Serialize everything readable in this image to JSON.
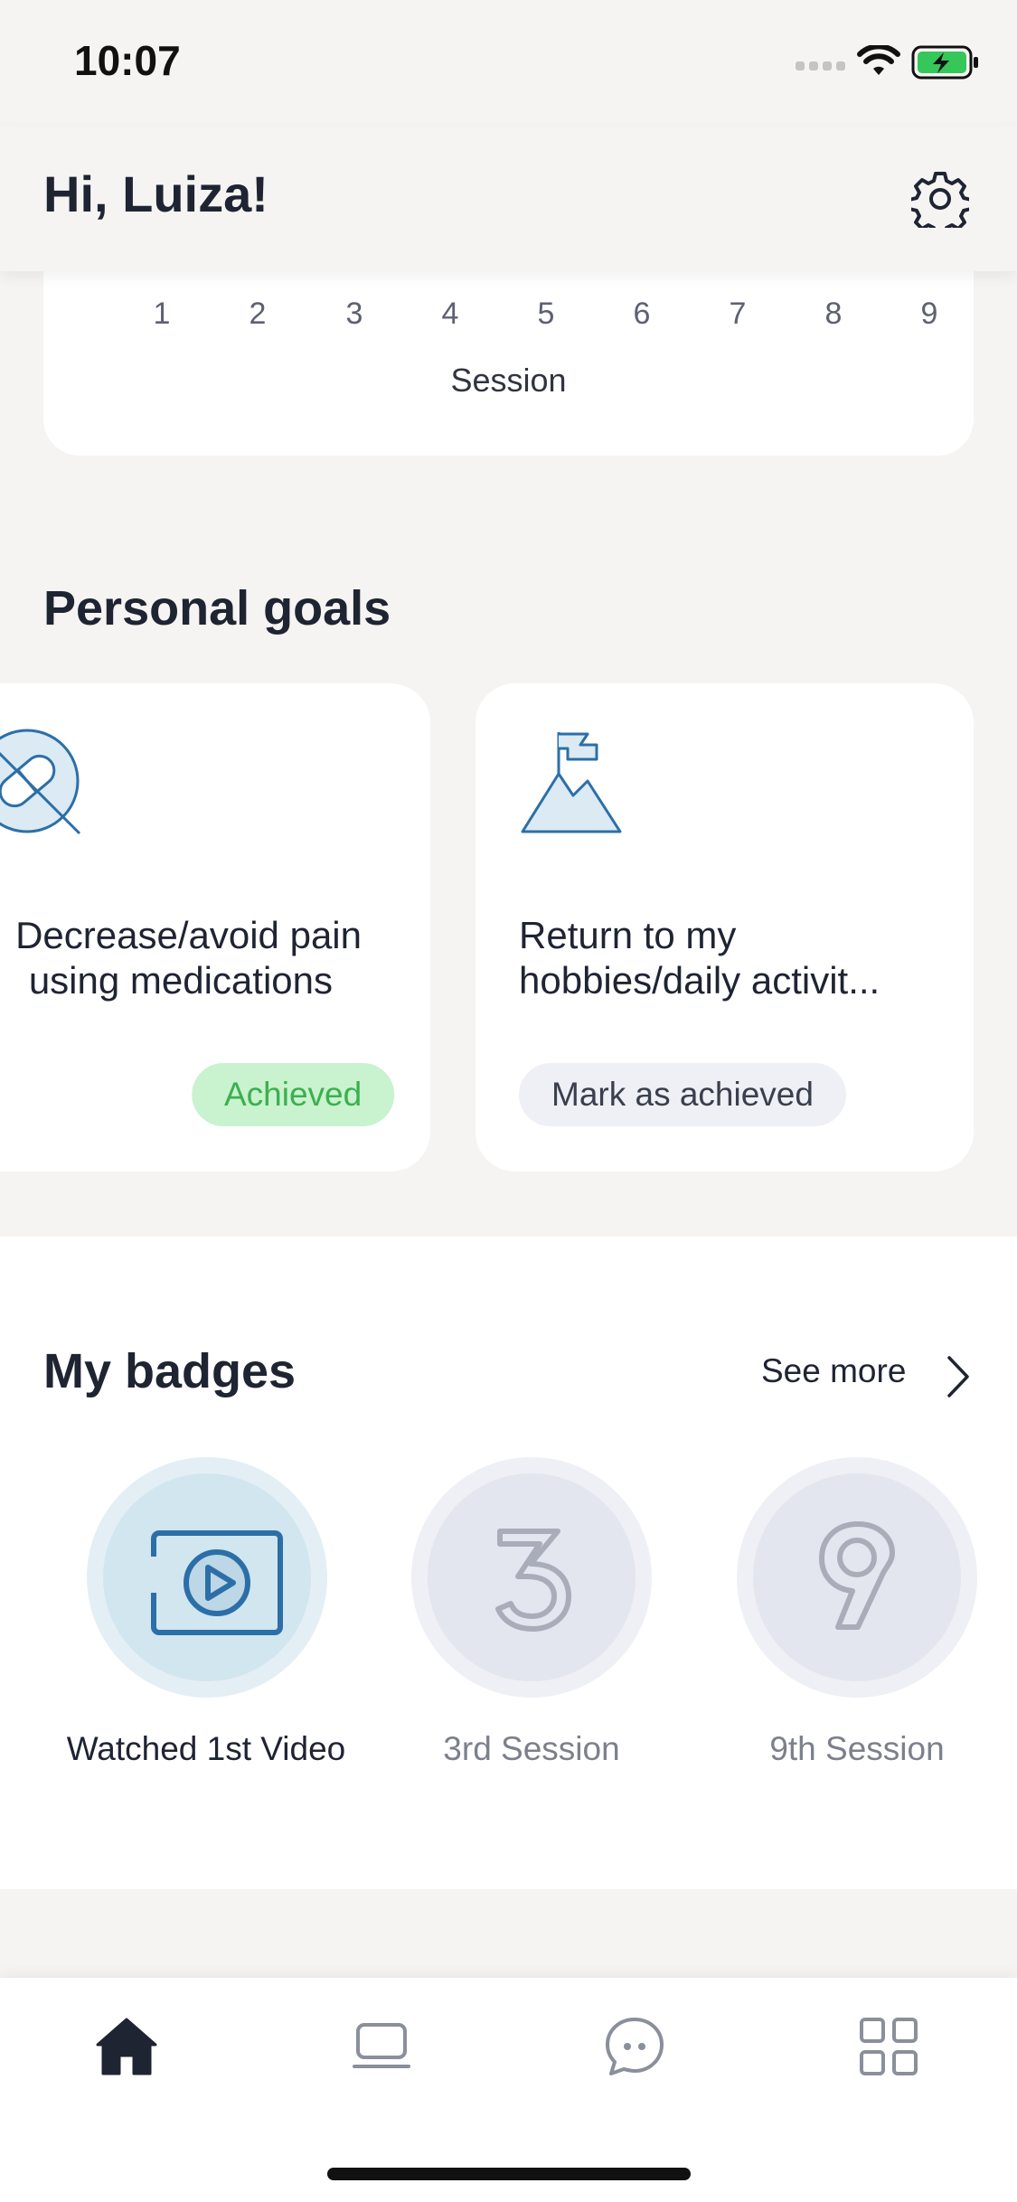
{
  "status_bar": {
    "time": "10:07"
  },
  "header": {
    "greeting": "Hi, Luiza!"
  },
  "chart": {
    "ticks": [
      "1",
      "2",
      "3",
      "4",
      "5",
      "6",
      "7",
      "8",
      "9"
    ],
    "axis_title": "Session"
  },
  "personal_goals": {
    "title": "Personal goals",
    "goals": [
      {
        "line1": "Decrease/avoid pain",
        "line2": "using medications",
        "status": "Achieved",
        "icon": "pill-crossed-icon"
      },
      {
        "line1": "Return to my",
        "line2": "hobbies/daily activit...",
        "status": "Mark as achieved",
        "icon": "mountain-flag-icon"
      }
    ]
  },
  "badges": {
    "title": "My badges",
    "see_more": "See more",
    "items": [
      {
        "label": "Watched 1st Video",
        "earned": true,
        "icon": "video-play-icon"
      },
      {
        "label": "3rd Session",
        "earned": false,
        "icon": "number-3-icon"
      },
      {
        "label": "9th Session",
        "earned": false,
        "icon": "number-9-icon"
      }
    ]
  },
  "nav": {
    "items": [
      "home-icon",
      "laptop-icon",
      "chat-icon",
      "grid-icon"
    ],
    "active": "home-icon"
  },
  "colors": {
    "accent_blue": "#2c6fa8",
    "achieved_bg": "#c9f2cf",
    "achieved_text": "#3bb04e",
    "background": "#f6f4f2"
  }
}
